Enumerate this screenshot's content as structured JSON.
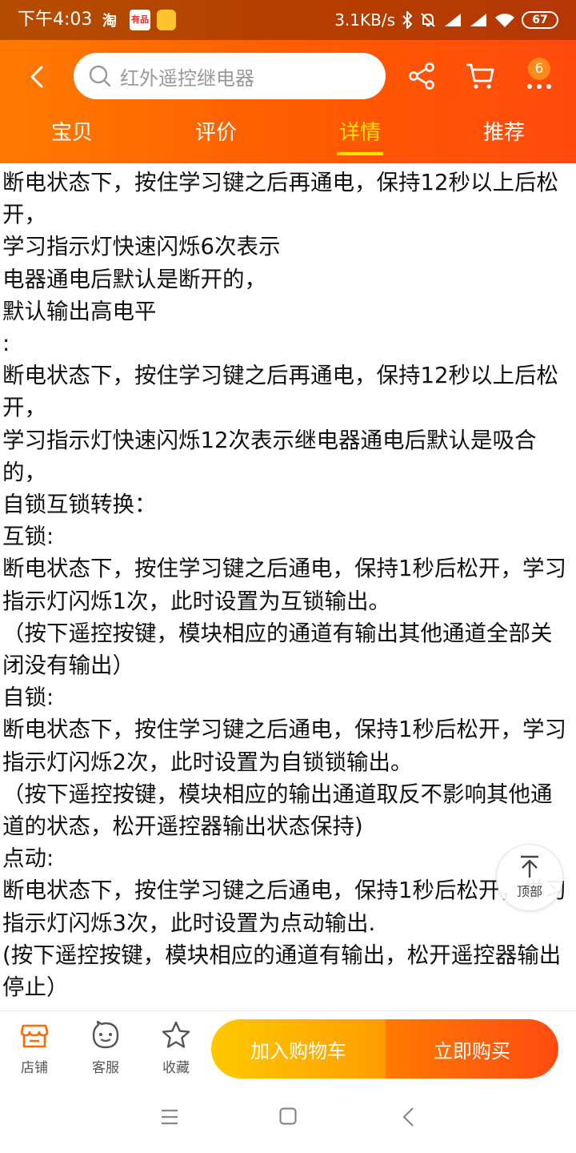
{
  "status_bar": {
    "time": "下午4:03",
    "app1": "淘",
    "app2": "有品",
    "speed": "3.1KB/s",
    "battery": "67"
  },
  "header": {
    "search_placeholder": "红外遥控继电器",
    "message_badge": "6"
  },
  "tabs": [
    {
      "label": "宝贝",
      "active": false
    },
    {
      "label": "评价",
      "active": false
    },
    {
      "label": "详情",
      "active": true
    },
    {
      "label": "推荐",
      "active": false
    }
  ],
  "content": {
    "lines": [
      "断电状态下，按住学习键之后再通电，保持12秒以上后松开，",
      "学习指示灯快速闪烁6次表示",
      "电器通电后默认是断开的，",
      "默认输出高电平",
      ":",
      "断电状态下，按住学习键之后再通电，保持12秒以上后松开，",
      "学习指示灯快速闪烁12次表示继电器通电后默认是吸合的，",
      "自锁互锁转换：",
      "互锁:",
      "断电状态下，按住学习键之后通电，保持1秒后松开，学习指示灯闪烁1次，此时设置为互锁输出。",
      "（按下遥控按键，模块相应的通道有输出其他通道全部关闭没有输出）",
      "自锁:",
      "断电状态下，按住学习键之后通电，保持1秒后松开，学习指示灯闪烁2次，此时设置为自锁锁输出。",
      "（按下遥控按键，模块相应的输出通道取反不影响其他通道的状态，松开遥控器输出状态保持)",
      "点动:",
      "断电状态下，按住学习键之后通电，保持1秒后松开，学习指示灯闪烁3次，此时设置为点动输出.",
      "(按下遥控按键，模块相应的通道有输出，松开遥控器输出停止）"
    ]
  },
  "back_to_top_label": "顶部",
  "bottom_bar": {
    "shop_label": "店铺",
    "service_label": "客服",
    "favorite_label": "收藏",
    "add_to_cart_label": "加入购物车",
    "buy_now_label": "立即购买"
  },
  "colors": {
    "accent": "#ff5a00",
    "active_tab": "#ffe100",
    "cart_button": "#ffb300",
    "buy_button": "#ff5a10"
  }
}
